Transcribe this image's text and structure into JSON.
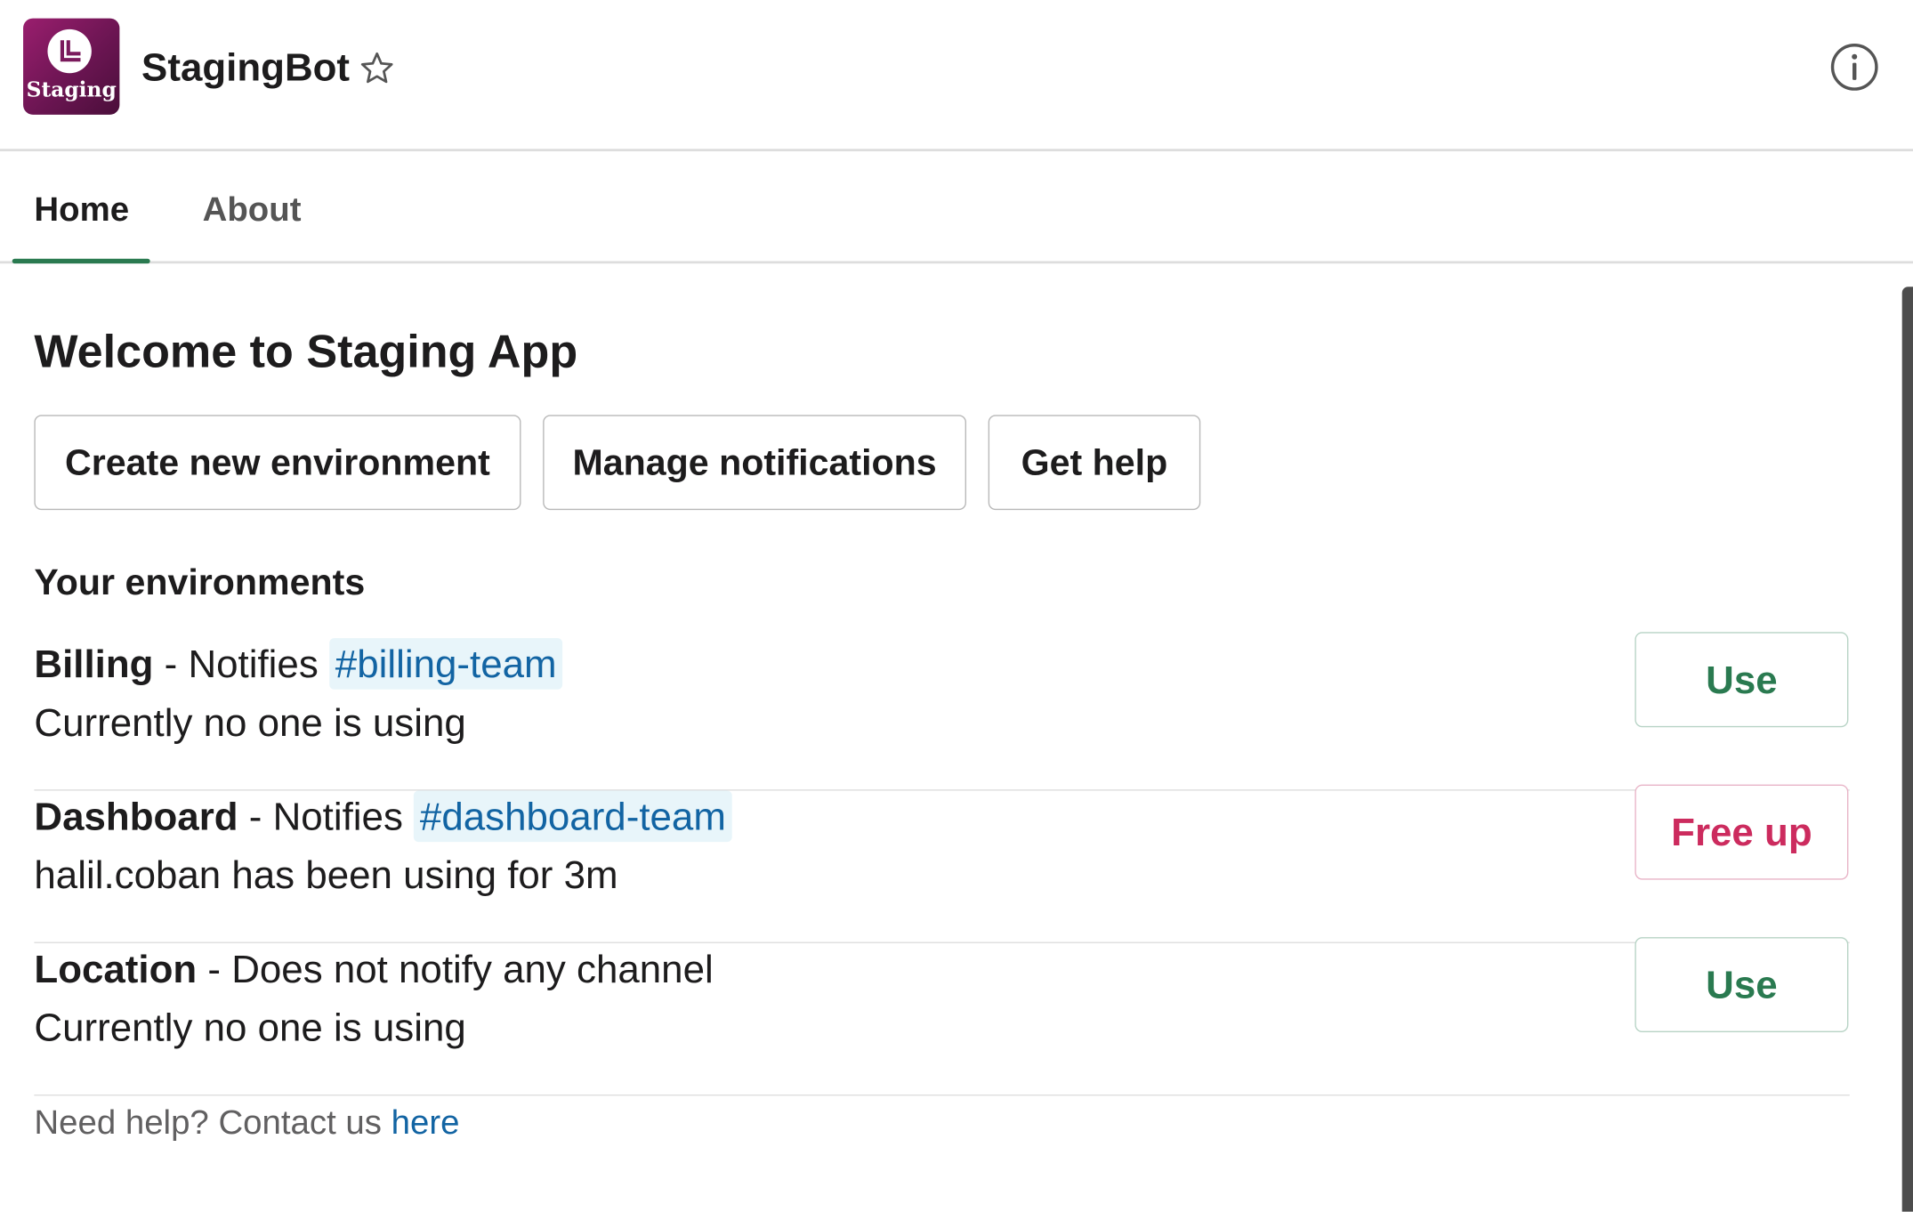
{
  "header": {
    "app_name": "StagingBot",
    "app_icon_text": "Staging",
    "star_icon": "star-icon",
    "info_icon": "info-icon"
  },
  "tabs": [
    {
      "label": "Home",
      "active": true
    },
    {
      "label": "About",
      "active": false
    }
  ],
  "main": {
    "title": "Welcome to Staging App",
    "actions": [
      {
        "label": "Create new environment"
      },
      {
        "label": "Manage notifications"
      },
      {
        "label": "Get help"
      }
    ],
    "section_title": "Your environments",
    "environments": [
      {
        "name": "Billing",
        "separator": " - ",
        "notify_prefix": "Notifies ",
        "channel": "#billing-team",
        "status": "Currently no one is using",
        "button_label": "Use"
      },
      {
        "name": "Dashboard",
        "separator": " - ",
        "notify_prefix": "Notifies ",
        "channel": "#dashboard-team",
        "status": "halil.coban has been using for 3m",
        "button_label": "Free up"
      },
      {
        "name": "Location",
        "separator": " - ",
        "notify_prefix": "Does not notify any channel",
        "channel": "",
        "status": "Currently no one is using",
        "button_label": "Use"
      }
    ],
    "footer": {
      "text": "Need help? Contact us ",
      "link": "here"
    }
  },
  "colors": {
    "accent_green": "#2a7a50",
    "danger_pink": "#cc2b5e",
    "link_blue": "#1264a3",
    "channel_bg": "#e8f5fa",
    "app_icon_purple": "#6b1552"
  }
}
